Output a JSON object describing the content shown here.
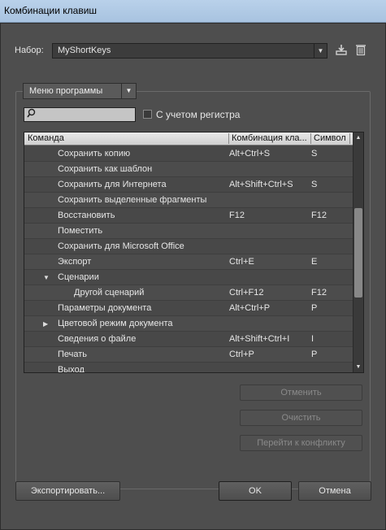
{
  "window": {
    "title": "Комбинации клавиш"
  },
  "set": {
    "label": "Набор:",
    "value": "MyShortKeys"
  },
  "icons": {
    "save": "save-to-disk-icon",
    "delete": "trash-icon"
  },
  "menu_select": {
    "value": "Меню программы"
  },
  "search": {
    "placeholder": "",
    "value": ""
  },
  "case_checkbox": {
    "label": "С учетом регистра",
    "checked": false
  },
  "table": {
    "headers": [
      "Команда",
      "Комбинация кла...",
      "Символ"
    ],
    "rows": [
      {
        "command": "Сохранить копию",
        "shortcut": "Alt+Ctrl+S",
        "symbol": "S",
        "indent": 0,
        "arrow": ""
      },
      {
        "command": "Сохранить как шаблон",
        "shortcut": "",
        "symbol": "",
        "indent": 0,
        "arrow": ""
      },
      {
        "command": "Сохранить для Интернета",
        "shortcut": "Alt+Shift+Ctrl+S",
        "symbol": "S",
        "indent": 0,
        "arrow": ""
      },
      {
        "command": "Сохранить выделенные фрагменты",
        "shortcut": "",
        "symbol": "",
        "indent": 0,
        "arrow": ""
      },
      {
        "command": "Восстановить",
        "shortcut": "F12",
        "symbol": "F12",
        "indent": 0,
        "arrow": ""
      },
      {
        "command": "Поместить",
        "shortcut": "",
        "symbol": "",
        "indent": 0,
        "arrow": ""
      },
      {
        "command": "Сохранить для Microsoft Office",
        "shortcut": "",
        "symbol": "",
        "indent": 0,
        "arrow": ""
      },
      {
        "command": "Экспорт",
        "shortcut": "Ctrl+E",
        "symbol": "E",
        "indent": 0,
        "arrow": ""
      },
      {
        "command": "Сценарии",
        "shortcut": "",
        "symbol": "",
        "indent": 0,
        "arrow": "▼"
      },
      {
        "command": "Другой сценарий",
        "shortcut": "Ctrl+F12",
        "symbol": "F12",
        "indent": 1,
        "arrow": ""
      },
      {
        "command": "Параметры документа",
        "shortcut": "Alt+Ctrl+P",
        "symbol": "P",
        "indent": 0,
        "arrow": ""
      },
      {
        "command": "Цветовой режим документа",
        "shortcut": "",
        "symbol": "",
        "indent": 0,
        "arrow": "▶"
      },
      {
        "command": "Сведения о файле",
        "shortcut": "Alt+Shift+Ctrl+I",
        "symbol": "I",
        "indent": 0,
        "arrow": ""
      },
      {
        "command": "Печать",
        "shortcut": "Ctrl+P",
        "symbol": "P",
        "indent": 0,
        "arrow": ""
      },
      {
        "command": "Выход",
        "shortcut": "",
        "symbol": "",
        "indent": 0,
        "arrow": ""
      }
    ]
  },
  "buttons": {
    "undo": "Отменить",
    "clear": "Очистить",
    "goto_conflict": "Перейти к конфликту",
    "export": "Экспортировать...",
    "ok": "OK",
    "cancel": "Отмена"
  }
}
